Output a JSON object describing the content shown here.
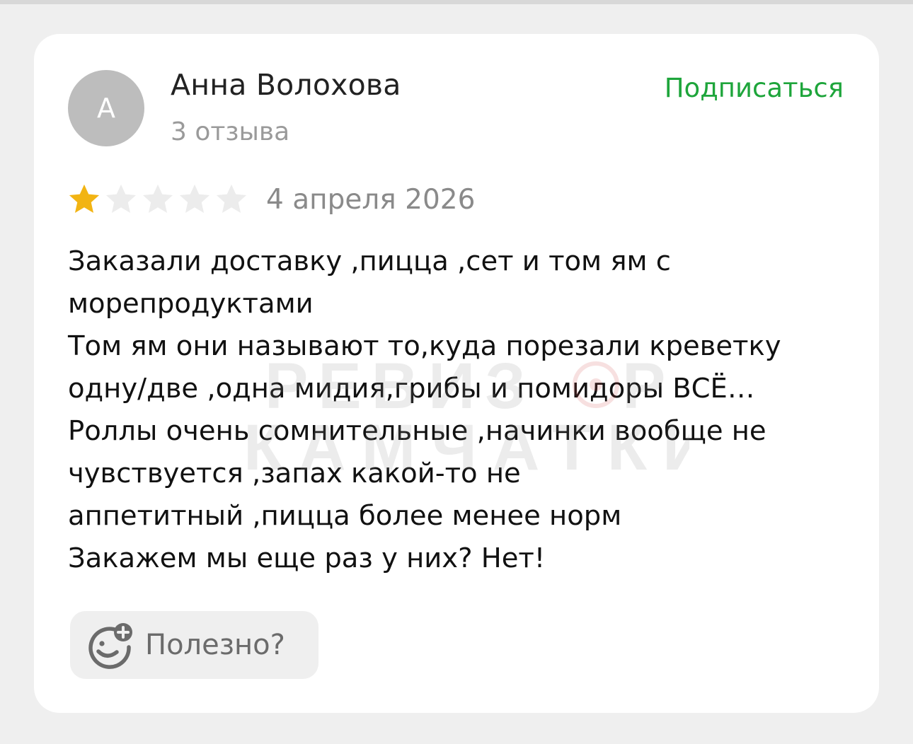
{
  "author": {
    "initial": "А",
    "name": "Анна Волохова",
    "reviews_count": "3 отзыва"
  },
  "subscribe_label": "Подписаться",
  "rating": {
    "value": 1,
    "max": 5
  },
  "date": "4 апреля 2026",
  "review_lines": [
    "Заказали доставку ,пицца ,сет и том ям с",
    "морепродуктами",
    "Том ям они называют то,куда порезали креветку",
    "одну/две ,одна мидия,грибы и помидоры ВСЁ…",
    "Роллы очень сомнительные ,начинки вообще не",
    "чувствуется ,запах какой-то не",
    "аппетитный ,пицца более менее норм",
    "Закажем мы еще раз у них? Нет!"
  ],
  "helpful_label": "Полезно?",
  "watermark": {
    "line1": "РЕВИЗОР",
    "line2": "КАМЧАТКИ"
  },
  "colors": {
    "accent_green": "#1ea53b",
    "star_filled": "#f2b413",
    "star_empty": "#ececec",
    "avatar_bg": "#bdbdbd"
  },
  "icons": {
    "rating": "star-icon",
    "helpful": "smile-plus-icon"
  }
}
